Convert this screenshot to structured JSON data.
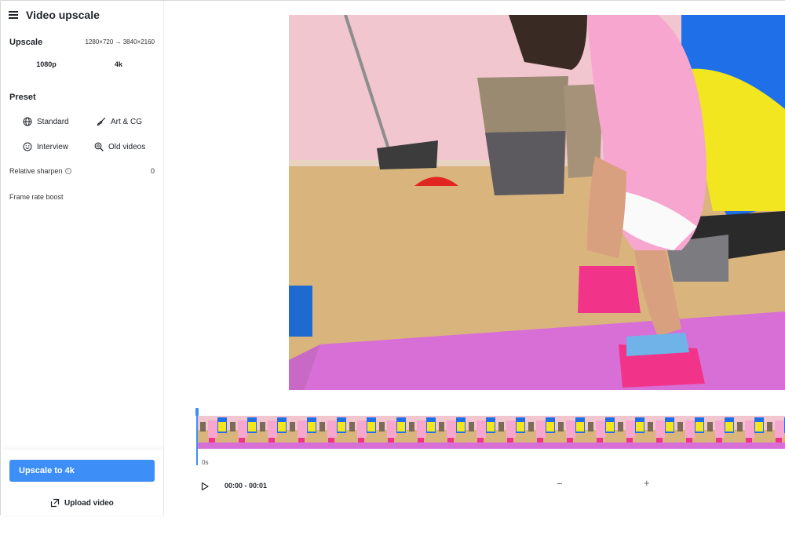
{
  "app": {
    "title": "Video upscale"
  },
  "upscale": {
    "heading": "Upscale",
    "resolution_range": "1280×720 → 3840×2160",
    "options": [
      "1080p",
      "4k"
    ]
  },
  "preset": {
    "heading": "Preset",
    "items": [
      {
        "label": "Standard",
        "icon": "globe-icon"
      },
      {
        "label": "Art & CG",
        "icon": "brush-icon"
      },
      {
        "label": "Interview",
        "icon": "smile-icon"
      },
      {
        "label": "Old videos",
        "icon": "search-icon"
      }
    ]
  },
  "settings": {
    "relative_sharpen": {
      "label": "Relative sharpen",
      "value": "0"
    },
    "frame_rate_boost": {
      "label": "Frame rate boost"
    }
  },
  "actions": {
    "upscale_button": "Upscale to 4k",
    "upload_button": "Upload video"
  },
  "player": {
    "time_range": "00:00 - 00:01",
    "timeline_start_label": "0s",
    "zoom_out": "−",
    "zoom_in": "+",
    "thumbnail_count": 20
  },
  "colors": {
    "accent": "#3d8ef7"
  }
}
